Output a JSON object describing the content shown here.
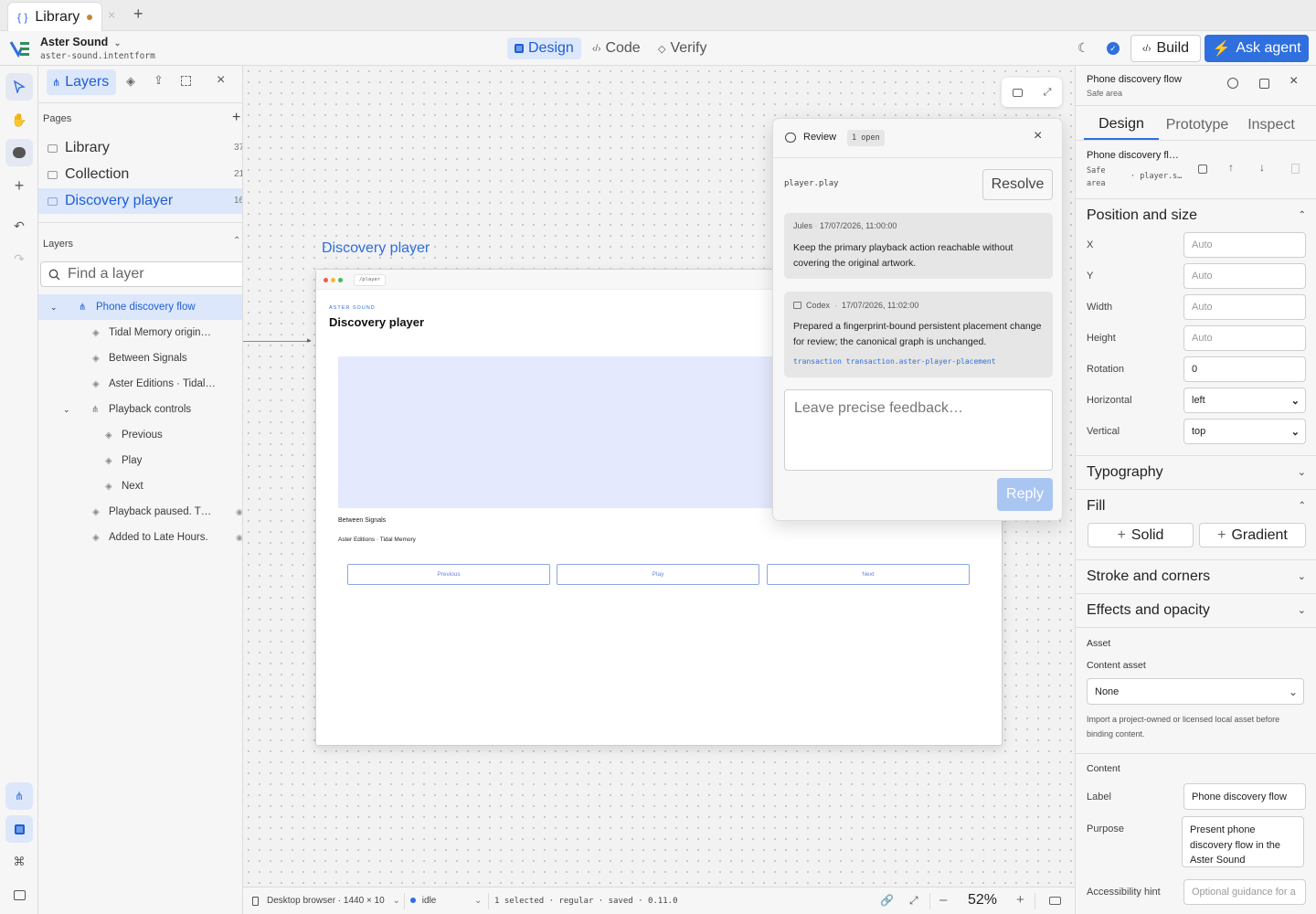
{
  "tabs": {
    "active_label": "Library"
  },
  "header": {
    "project_name": "Aster Sound",
    "project_file": "aster-sound.intentform",
    "modes": [
      "Design",
      "Code",
      "Verify"
    ],
    "build_label": "Build",
    "agent_label": "Ask agent"
  },
  "layers_panel": {
    "tab_label": "Layers",
    "pages_title": "Pages",
    "pages": [
      {
        "label": "Library",
        "count": "37"
      },
      {
        "label": "Collection",
        "count": "21"
      },
      {
        "label": "Discovery player",
        "count": "16"
      }
    ],
    "layers_title": "Layers",
    "search_placeholder": "Find a layer",
    "layers": [
      "Phone discovery flow",
      "Tidal Memory origin…",
      "Between Signals",
      "Aster Editions · Tidal…",
      "Playback controls",
      "Previous",
      "Play",
      "Next",
      "Playback paused. T…",
      "Added to Late Hours."
    ]
  },
  "canvas": {
    "frame_label": "Discovery player",
    "url_pill": "/player",
    "eyebrow": "ASTER SOUND",
    "heading": "Discovery player",
    "track_title": "Between Signals",
    "track_meta": "Aster Editions · Tidal Memory",
    "buttons": [
      "Previous",
      "Play",
      "Next"
    ]
  },
  "review": {
    "title": "Review",
    "open_badge": "1 open",
    "target": "player.play",
    "resolve_label": "Resolve",
    "comments": [
      {
        "author": "Jules",
        "time": "17/07/2026, 11:00:00",
        "body": "Keep the primary playback action reachable without covering the original artwork."
      },
      {
        "author": "Codex",
        "time": "17/07/2026, 11:02:00",
        "body": "Prepared a fingerprint-bound persistent placement change for review; the canonical graph is unchanged.",
        "link": "transaction transaction.aster-player-placement"
      }
    ],
    "feedback_placeholder": "Leave precise feedback…",
    "reply_label": "Reply"
  },
  "statusbar": {
    "device": "Desktop browser · 1440 × 10",
    "state": "idle",
    "info": "1 selected · regular · saved · 0.11.0",
    "zoom": "52%"
  },
  "inspector": {
    "title": "Phone discovery flow",
    "subtitle": "Safe area",
    "tabs": [
      "Design",
      "Prototype",
      "Inspect"
    ],
    "selection_name": "Phone discovery fl…",
    "selection_area": "Safe area",
    "selection_id": "· player.s…",
    "position_title": "Position and size",
    "fields": [
      {
        "label": "X",
        "value": "",
        "placeholder": "Auto"
      },
      {
        "label": "Y",
        "value": "",
        "placeholder": "Auto"
      },
      {
        "label": "Width",
        "value": "",
        "placeholder": "Auto"
      },
      {
        "label": "Height",
        "value": "",
        "placeholder": "Auto"
      },
      {
        "label": "Rotation",
        "value": "0",
        "placeholder": ""
      }
    ],
    "horizontal_label": "Horizontal",
    "horizontal_value": "left",
    "vertical_label": "Vertical",
    "vertical_value": "top",
    "typography_title": "Typography",
    "fill_title": "Fill",
    "solid_label": "Solid",
    "gradient_label": "Gradient",
    "stroke_title": "Stroke and corners",
    "effects_title": "Effects and opacity",
    "asset_title": "Asset",
    "content_asset_label": "Content asset",
    "content_asset_value": "None",
    "asset_help": "Import a project-owned or licensed local asset before binding content.",
    "content_title": "Content",
    "label_label": "Label",
    "label_value": "Phone discovery flow",
    "purpose_label": "Purpose",
    "purpose_value": "Present phone discovery flow in the Aster Sound",
    "hint_label": "Accessibility hint",
    "hint_placeholder": "Optional guidance for a"
  },
  "colors": {
    "accent": "#2f6fde",
    "active_bg": "#dde7fb",
    "artwork": "#e5e9fd"
  }
}
